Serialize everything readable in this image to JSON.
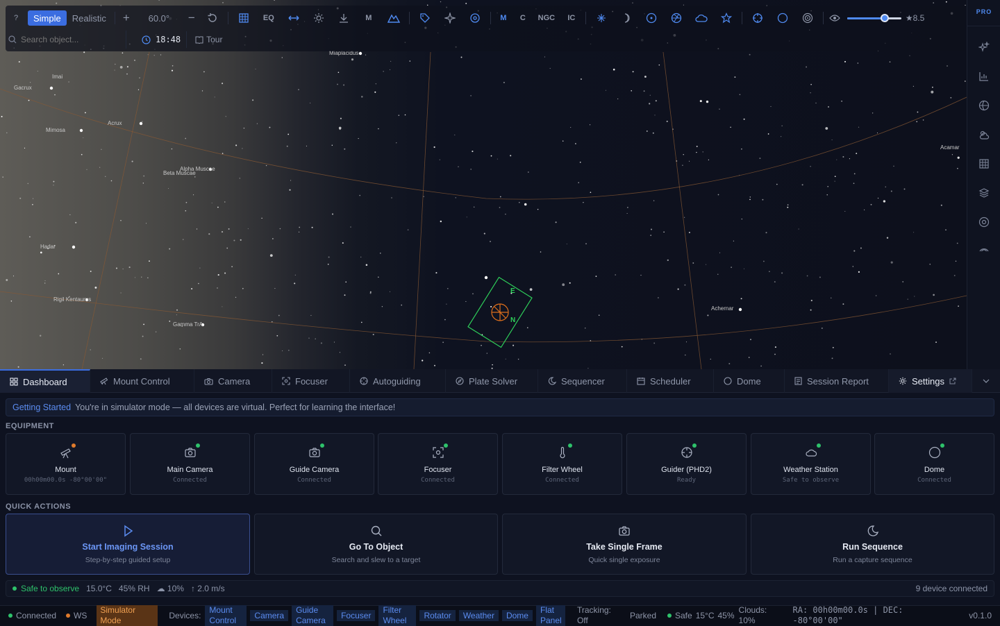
{
  "toolbar": {
    "help": "?",
    "mode_simple": "Simple",
    "mode_realistic": "Realistic",
    "zoom_in": "+",
    "fov": "60.0°",
    "zoom_out": "−",
    "eq_label": "EQ",
    "messier_label": "M",
    "cat_m": "M",
    "cat_c": "C",
    "cat_ngc": "NGC",
    "cat_ic": "IC",
    "magnitude": "★8.5",
    "magnitude_fraction": 0.7,
    "search_placeholder": "Search object...",
    "time": "18:48",
    "tour": "Tour"
  },
  "rightbar": {
    "badge": "PRO",
    "icons": [
      "sparkle-icon",
      "chart-icon",
      "globe-icon",
      "weather-icon",
      "grid-icon",
      "layers-icon",
      "target-icon",
      "antenna-icon"
    ]
  },
  "sky": {
    "labels": [
      {
        "text": "Imai"
      },
      {
        "text": "Gacrux"
      },
      {
        "text": "Acrux"
      },
      {
        "text": "Mimosa"
      },
      {
        "text": "Alpha Muscae"
      },
      {
        "text": "Beta Muscae"
      },
      {
        "text": "Hadar"
      },
      {
        "text": "Rigil Kentaurus"
      },
      {
        "text": "Gamma TrA"
      },
      {
        "text": "Miaplacidus"
      },
      {
        "text": "Acamar"
      },
      {
        "text": "Achernar"
      }
    ],
    "fov_marks": {
      "east": "E",
      "north": "N"
    }
  },
  "tabs": [
    {
      "label": "Dashboard",
      "icon": "dashboard-icon"
    },
    {
      "label": "Mount Control",
      "icon": "telescope-icon"
    },
    {
      "label": "Camera",
      "icon": "camera-icon"
    },
    {
      "label": "Focuser",
      "icon": "focus-icon"
    },
    {
      "label": "Autoguiding",
      "icon": "crosshair-icon"
    },
    {
      "label": "Plate Solver",
      "icon": "compass-icon"
    },
    {
      "label": "Sequencer",
      "icon": "moon-icon"
    },
    {
      "label": "Scheduler",
      "icon": "calendar-icon"
    },
    {
      "label": "Dome",
      "icon": "circle-icon"
    },
    {
      "label": "Session Report",
      "icon": "report-icon"
    },
    {
      "label": "Settings",
      "icon": "gear-icon"
    }
  ],
  "banner": {
    "title": "Getting Started",
    "text": "You're in simulator mode — all devices are virtual. Perfect for learning the interface!"
  },
  "equipment": {
    "heading": "EQUIPMENT",
    "cards": [
      {
        "name": "Mount",
        "status": "00h00m00.0s -80°00'00\"",
        "dot": "#e07b2c",
        "icon": "telescope-icon"
      },
      {
        "name": "Main Camera",
        "status": "Connected",
        "dot": "#2ec26b",
        "icon": "camera-icon"
      },
      {
        "name": "Guide Camera",
        "status": "Connected",
        "dot": "#2ec26b",
        "icon": "camera-icon"
      },
      {
        "name": "Focuser",
        "status": "Connected",
        "dot": "#2ec26b",
        "icon": "focus-icon"
      },
      {
        "name": "Filter Wheel",
        "status": "Connected",
        "dot": "#2ec26b",
        "icon": "thermometer-icon"
      },
      {
        "name": "Guider (PHD2)",
        "status": "Ready",
        "dot": "#2ec26b",
        "icon": "crosshair-icon"
      },
      {
        "name": "Weather Station",
        "status": "Safe to observe",
        "dot": "#2ec26b",
        "icon": "cloud-icon"
      },
      {
        "name": "Dome",
        "status": "Connected",
        "dot": "#2ec26b",
        "icon": "circle-icon"
      }
    ]
  },
  "quick_actions": {
    "heading": "QUICK ACTIONS",
    "cards": [
      {
        "title": "Start Imaging Session",
        "sub": "Step-by-step guided setup",
        "icon": "play-icon"
      },
      {
        "title": "Go To Object",
        "sub": "Search and slew to a target",
        "icon": "search-icon"
      },
      {
        "title": "Take Single Frame",
        "sub": "Quick single exposure",
        "icon": "camera-icon"
      },
      {
        "title": "Run Sequence",
        "sub": "Run a capture sequence",
        "icon": "moon-icon"
      }
    ]
  },
  "status": {
    "safe": "Safe to observe",
    "temp": "15.0°C",
    "humidity": "45% RH",
    "clouds": "☁ 10%",
    "wind": "↑ 2.0 m/s",
    "devices": "9 device connected"
  },
  "bottombar": {
    "connected": "Connected",
    "ws": "WS",
    "sim_mode": "Simulator Mode",
    "devices_label": "Devices:",
    "devices": [
      "Mount Control",
      "Camera",
      "Guide Camera",
      "Focuser",
      "Filter Wheel",
      "Rotator",
      "Weather",
      "Dome",
      "Flat Panel"
    ],
    "tracking": "Tracking: Off",
    "parked": "Parked",
    "safe": "Safe",
    "temp": "15°C",
    "humidity": "45%",
    "clouds": "Clouds: 10%",
    "radec": "RA: 00h00m00.0s | DEC: -80°00'00\"",
    "version": "v0.1.0"
  },
  "colors": {
    "accent": "#3b6de0",
    "ok": "#2ec26b",
    "warn": "#e07b2c",
    "fov": "#2ecf5a",
    "reticle": "#e0701c"
  }
}
